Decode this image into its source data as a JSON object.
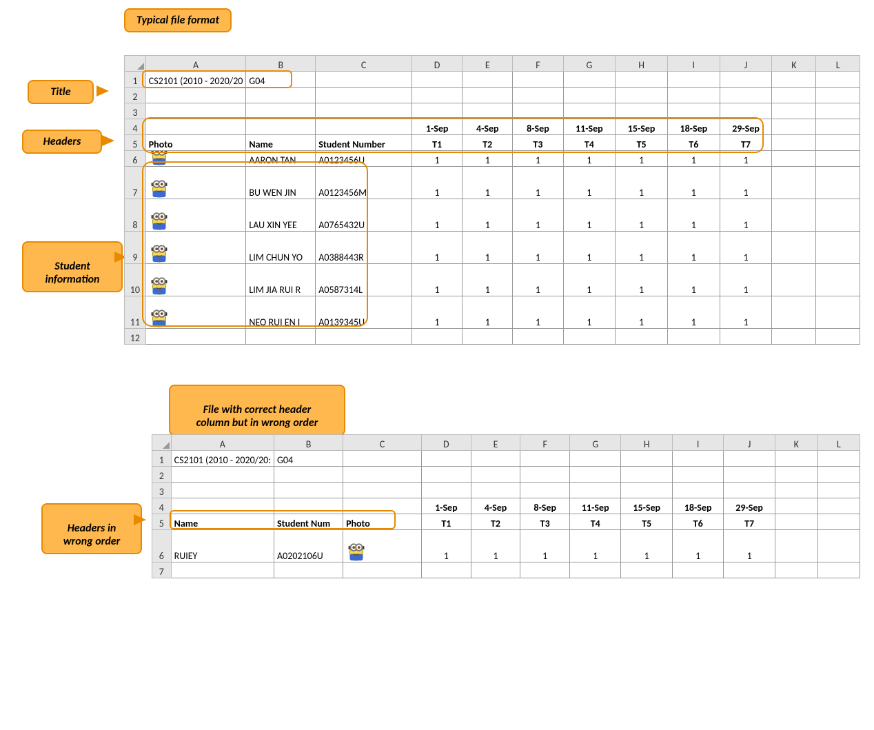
{
  "callouts": {
    "typical_format": "Typical file format",
    "title": "Title",
    "headers": "Headers",
    "student_info": "Student\ninformation",
    "wrong_order_callout": "File with correct header\ncolumn but in wrong order",
    "headers_wrong": "Headers in\nwrong order"
  },
  "columns": [
    "A",
    "B",
    "C",
    "D",
    "E",
    "F",
    "G",
    "H",
    "I",
    "J",
    "K",
    "L"
  ],
  "sheet1": {
    "title": "CS2101 (2010 - 2020/20",
    "title_extra": "G04",
    "dates": [
      "1-Sep",
      "4-Sep",
      "8-Sep",
      "11-Sep",
      "15-Sep",
      "18-Sep",
      "29-Sep"
    ],
    "header_row": [
      "Photo",
      "Name",
      "Student Number",
      "T1",
      "T2",
      "T3",
      "T4",
      "T5",
      "T6",
      "T7"
    ],
    "rows": [
      {
        "name": "AARON TAN",
        "sid": "A0123456U",
        "vals": [
          "1",
          "1",
          "1",
          "1",
          "1",
          "1",
          "1"
        ],
        "tall": false
      },
      {
        "name": "BU WEN JIN",
        "sid": "A0123456M",
        "vals": [
          "1",
          "1",
          "1",
          "1",
          "1",
          "1",
          "1"
        ],
        "tall": true
      },
      {
        "name": "LAU XIN YEE",
        "sid": "A0765432U",
        "vals": [
          "1",
          "1",
          "1",
          "1",
          "1",
          "1",
          "1"
        ],
        "tall": true
      },
      {
        "name": "LIM CHUN YO",
        "sid": "A0388443R",
        "vals": [
          "1",
          "1",
          "1",
          "1",
          "1",
          "1",
          "1"
        ],
        "tall": true
      },
      {
        "name": "LIM JIA RUI R",
        "sid": "A0587314L",
        "vals": [
          "1",
          "1",
          "1",
          "1",
          "1",
          "1",
          "1"
        ],
        "tall": true
      },
      {
        "name": "NEO RUI EN I",
        "sid": "A0139345U",
        "vals": [
          "1",
          "1",
          "1",
          "1",
          "1",
          "1",
          "1"
        ],
        "tall": true
      }
    ],
    "row_numbers": [
      "1",
      "2",
      "3",
      "4",
      "5",
      "6",
      "7",
      "8",
      "9",
      "10",
      "11",
      "12"
    ]
  },
  "sheet2": {
    "title": "CS2101 (2010 - 2020/20:",
    "title_extra": "G04",
    "dates": [
      "1-Sep",
      "4-Sep",
      "8-Sep",
      "11-Sep",
      "15-Sep",
      "18-Sep",
      "29-Sep"
    ],
    "header_row": [
      "Name",
      "Student Num",
      "Photo",
      "T1",
      "T2",
      "T3",
      "T4",
      "T5",
      "T6",
      "T7"
    ],
    "rows": [
      {
        "name": "RUIEY",
        "sid": "A0202106U",
        "vals": [
          "1",
          "1",
          "1",
          "1",
          "1",
          "1",
          "1"
        ],
        "tall": true
      }
    ],
    "row_numbers": [
      "1",
      "2",
      "3",
      "4",
      "5",
      "6",
      "7"
    ]
  },
  "col_widths": {
    "row": 26,
    "A": 74,
    "B": 100,
    "C": 150,
    "D": 82,
    "E": 82,
    "F": 82,
    "G": 82,
    "H": 82,
    "I": 82,
    "J": 82,
    "K": 82,
    "L": 82
  }
}
